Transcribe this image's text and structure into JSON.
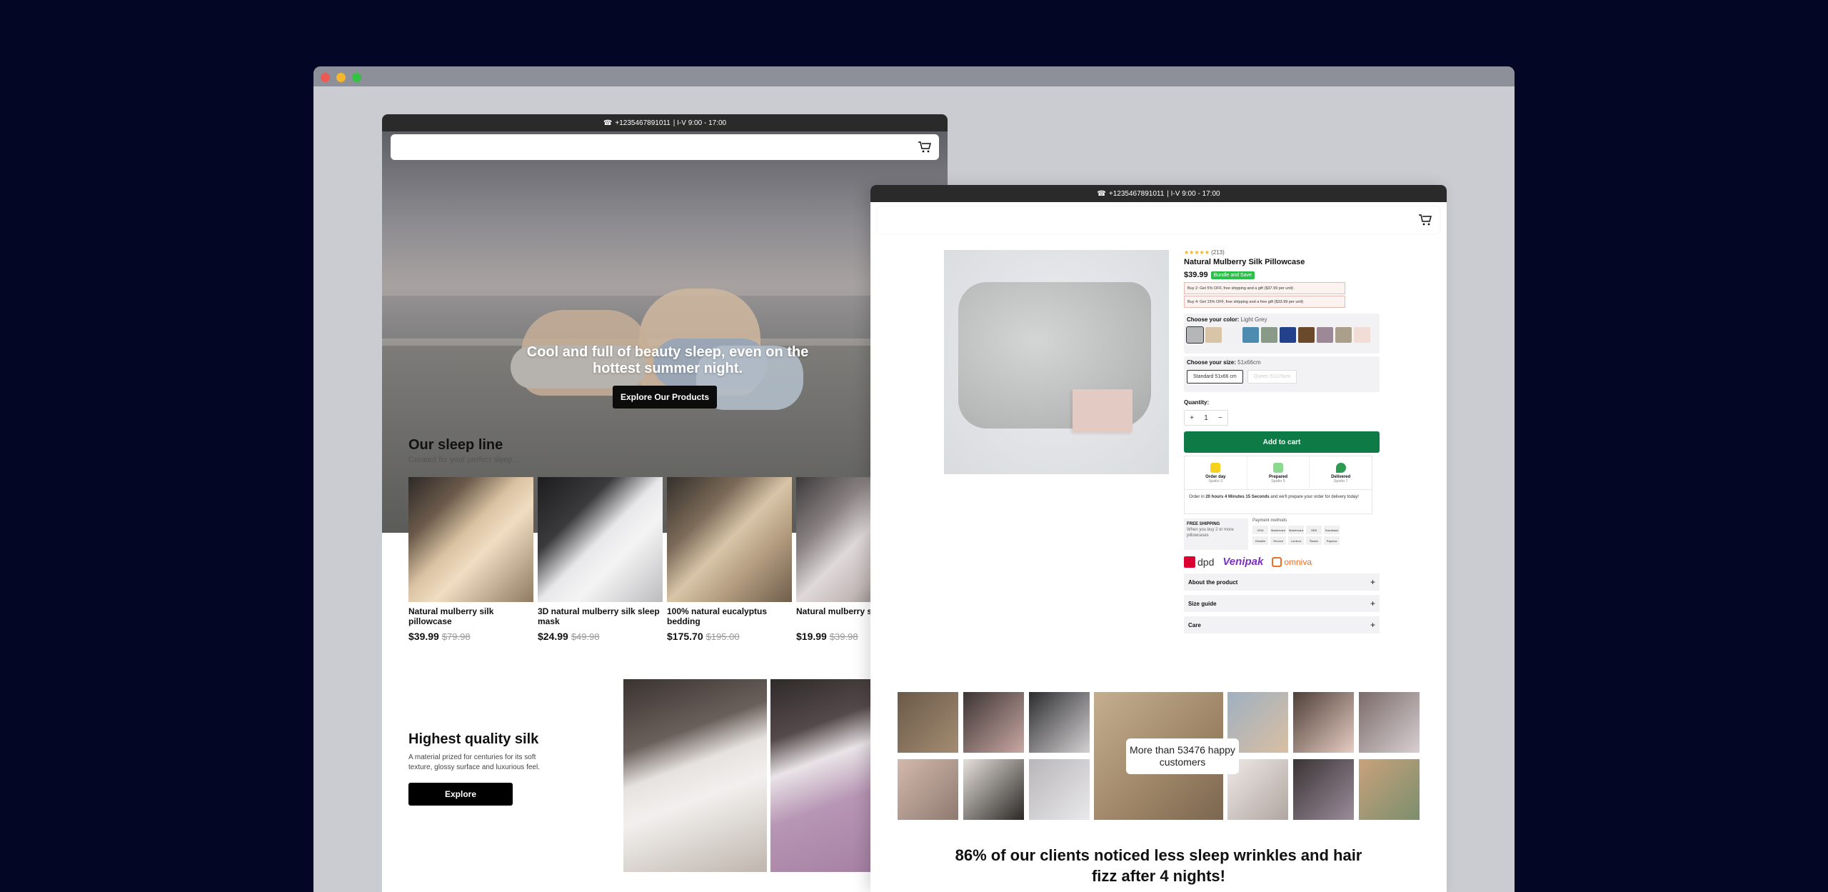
{
  "contact": {
    "phone": "+1235467891011",
    "hours": "| I-V 9:00 - 17:00"
  },
  "home": {
    "hero": {
      "title": "Cool and full of beauty sleep, even on the hottest summer night.",
      "cta": "Explore Our Products"
    },
    "sleep_line": {
      "title": "Our sleep line",
      "subtitle": "Created for your perfect sleep..."
    },
    "products": [
      {
        "name": "Natural mulberry silk pillowcase",
        "price": "$39.99",
        "old_price": "$79.98"
      },
      {
        "name": "3D natural mulberry silk sleep mask",
        "price": "$24.99",
        "old_price": "$49.98"
      },
      {
        "name": "100% natural eucalyptus bedding",
        "price": "$175.70",
        "old_price": "$195.00"
      },
      {
        "name": "Natural mulberry si",
        "price": "$19.99",
        "old_price": "$39.98"
      }
    ],
    "quality": {
      "title": "Highest quality silk",
      "description": "A material prized for centuries for its soft texture, glossy surface and luxurious feel.",
      "cta": "Explore"
    }
  },
  "product": {
    "rating_count": "(213)",
    "title": "Natural Mulberry Silk Pillowcase",
    "price": "$39.99",
    "badge": "Bundle and Save",
    "offers": [
      "Buy 2: Get 5% OFF, free shipping and a gift ($37.99 per unit)",
      "Buy 4: Get 15% OFF, free shipping and a free gift ($33.99 per unit)"
    ],
    "color_label": "Choose your color:",
    "color_value": "Light Grey",
    "swatches": [
      "#b5b6b8",
      "#d8c4a6",
      "#f1f1f3",
      "#4e8bb0",
      "#8a9a89",
      "#23418a",
      "#6b4a2c",
      "#9c8896",
      "#a99f8a",
      "#f1dcd6"
    ],
    "size_label": "Choose your size:",
    "size_value": "51x66cm",
    "sizes": [
      "Standard 51x66 cm",
      "Queen 51x76cm"
    ],
    "quantity_label": "Quantity:",
    "quantity": "1",
    "add_to_cart": "Add to cart",
    "delivery_steps": [
      {
        "title": "Order day",
        "date": "Spalio 3",
        "color": "#f6d21e"
      },
      {
        "title": "Prepared",
        "date": "Spalio 5",
        "color": "#8bd88f"
      },
      {
        "title": "Delivered",
        "date": "Spalio 7",
        "color": "#2c9b52"
      }
    ],
    "countdown_pre": "Order in ",
    "countdown_time": "20 hours 4 Minutes 15 Seconds",
    "countdown_post": " and we'll prepare your order for delivery today!",
    "free_shipping_title": "FREE SHIPPING",
    "free_shipping_note": "When you buy 2 or more pillowcases",
    "payment_label": "Payment methods",
    "payment_methods": [
      "VISA",
      "Mastercard",
      "Mastercard",
      "SEB",
      "Swedbank",
      "Citadele",
      "Revolut",
      "Luminor",
      "Šiauliu",
      "Paysera"
    ],
    "carriers": {
      "dpd": "dpd",
      "venipak": "Venipak",
      "omniva": "omniva"
    },
    "accordion": [
      "About the product",
      "Size guide",
      "Care"
    ],
    "happy_customers": "More than 53476 happy customers",
    "headline": "86% of our clients noticed less sleep wrinkles and hair fizz after 4 nights!"
  }
}
